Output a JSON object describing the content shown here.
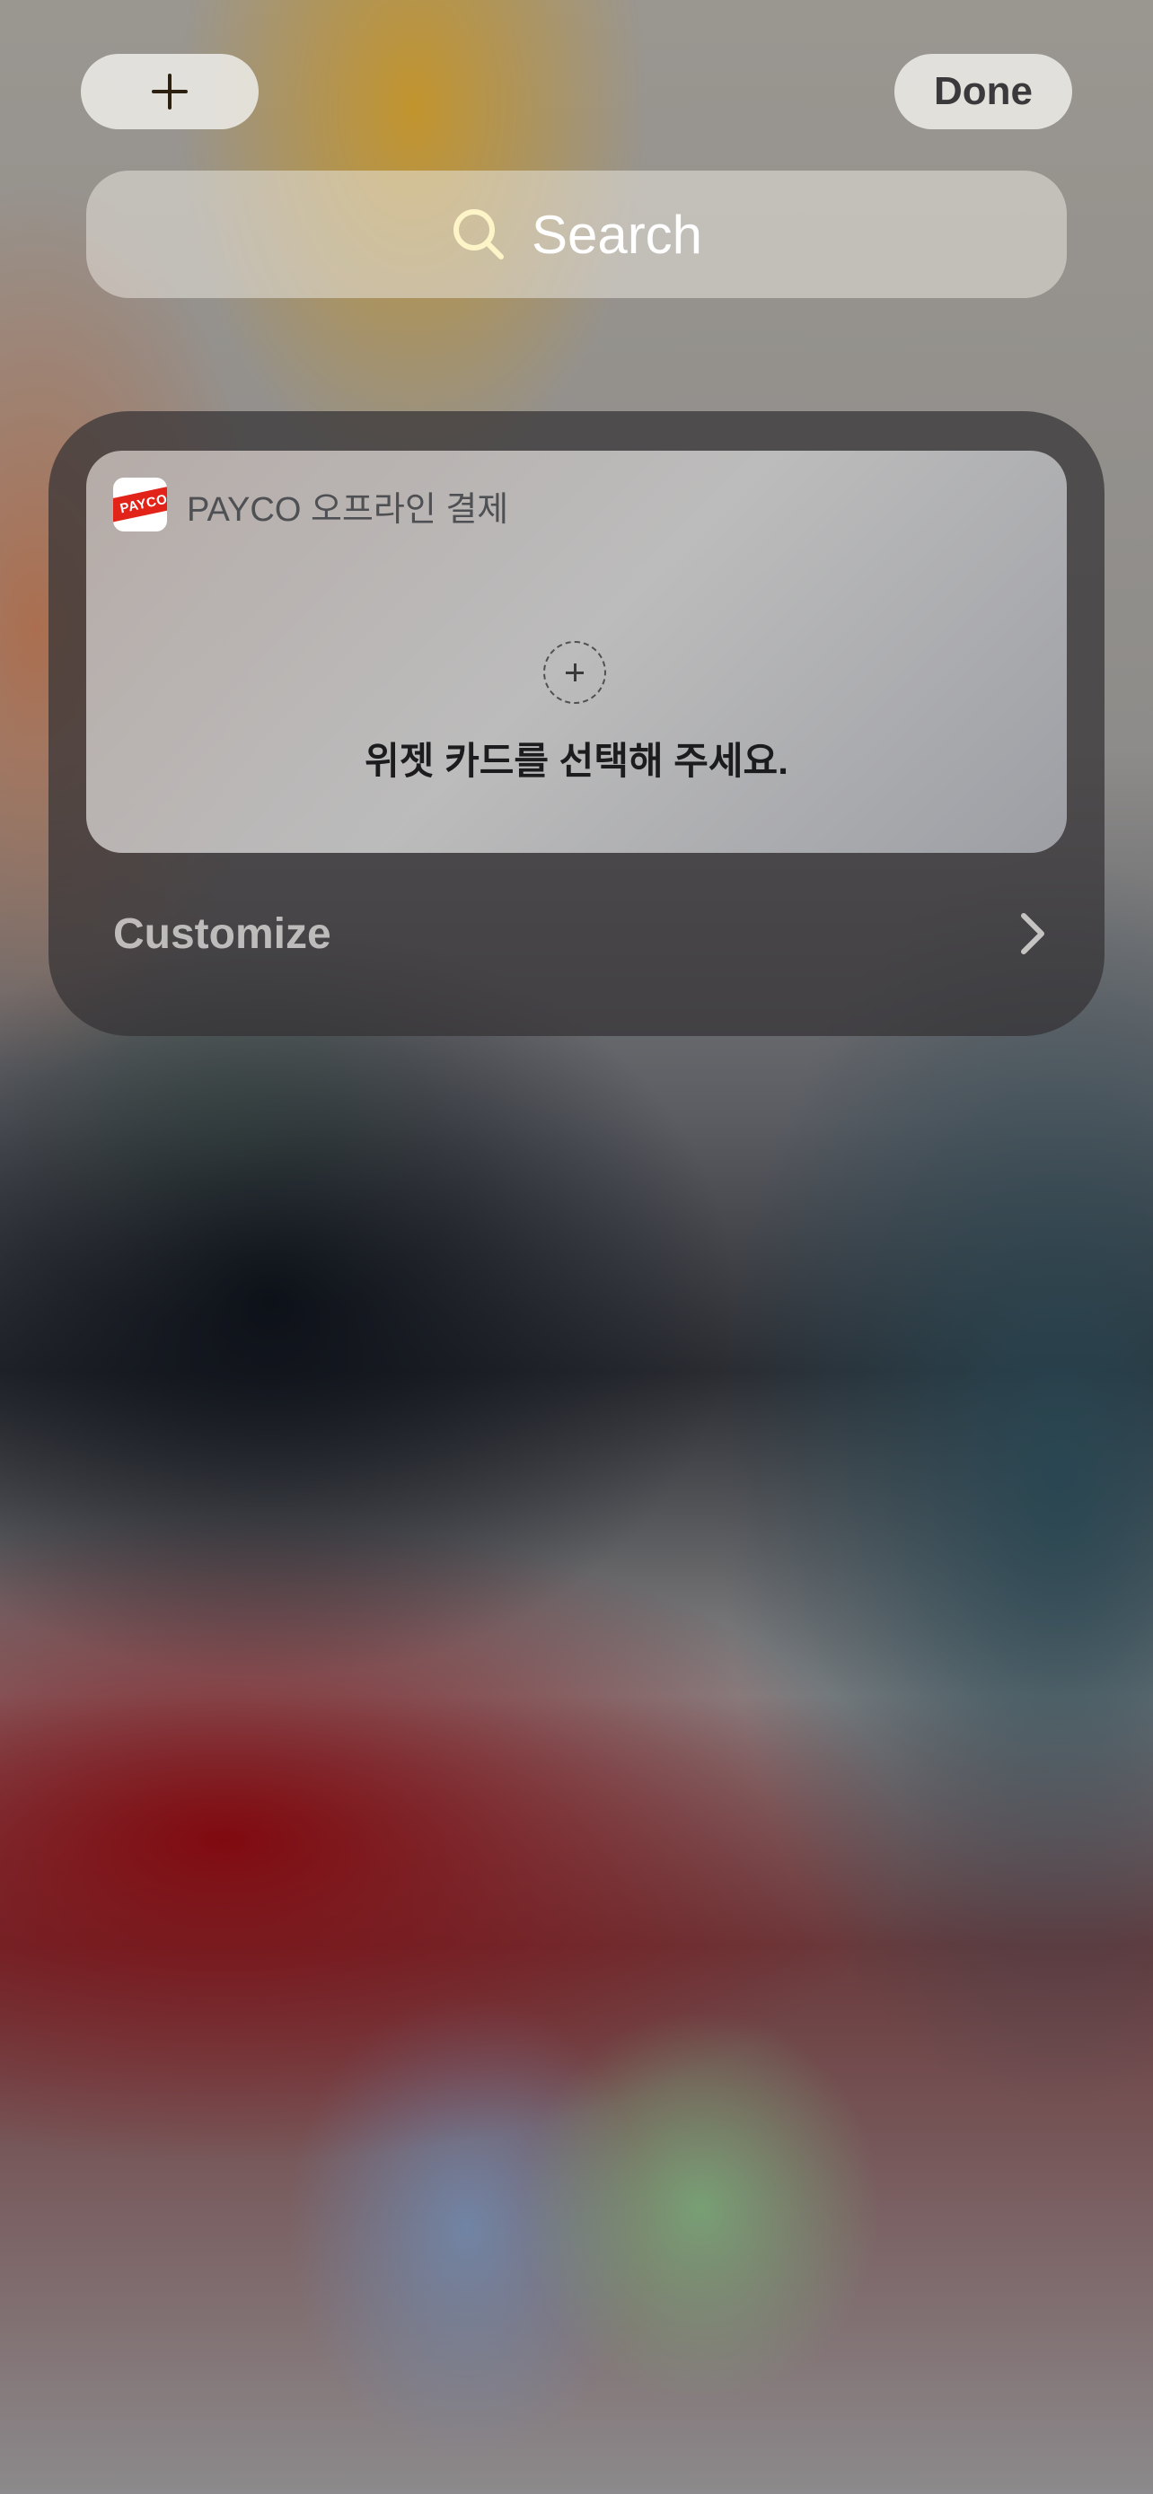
{
  "wallpaper": {
    "accent_colors": [
      "#c49428",
      "#0a0e16",
      "#800a10",
      "#28464f",
      "#78aa78"
    ]
  },
  "toolbar": {
    "add_icon": "plus-icon",
    "done_label": "Done"
  },
  "search": {
    "icon": "search-icon",
    "label": "Search"
  },
  "widget": {
    "app_icon": "payco-app-icon",
    "app_icon_text": "PAYCO",
    "app_name": "PAYCO 오프라인 결제",
    "add_card_icon": "plus-circle-icon",
    "prompt": "위젯 카드를 선택해 주세요.",
    "brand_color": "#e2231a"
  },
  "customize": {
    "label": "Customize",
    "chevron_icon": "chevron-right-icon"
  }
}
